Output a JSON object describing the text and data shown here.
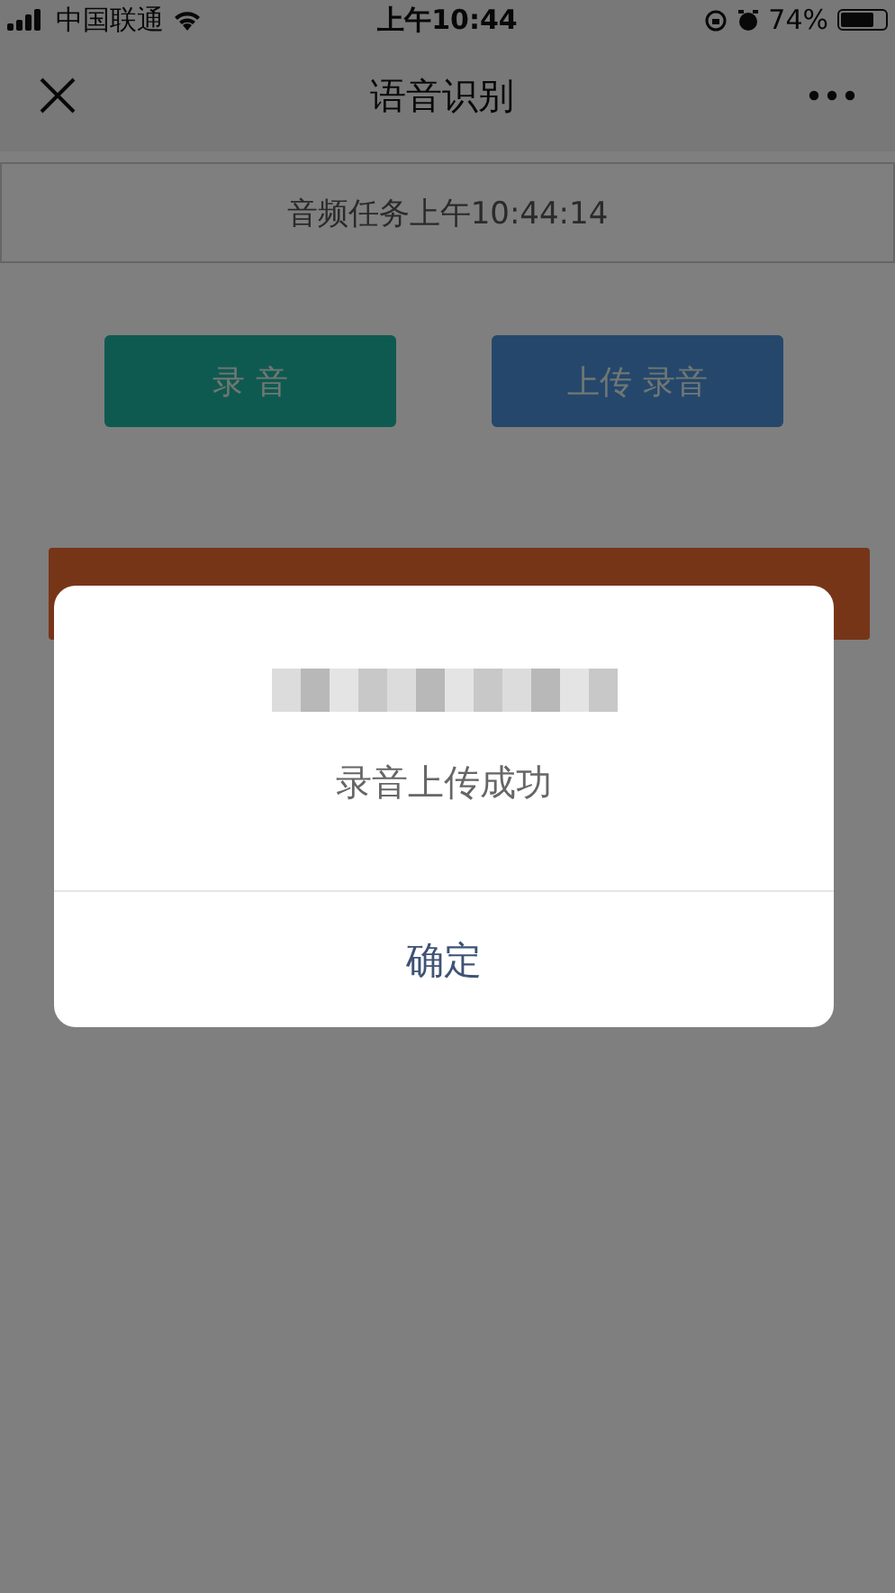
{
  "status_bar": {
    "carrier": "中国联通",
    "time": "上午10:44",
    "battery": {
      "text": "74%",
      "level": 0.74
    }
  },
  "nav": {
    "title": "语音识别"
  },
  "task_label": "音频任务上午10:44:14",
  "buttons": [
    {
      "label": "录 音",
      "kind": "record"
    },
    {
      "label": "上传 录音",
      "kind": "upload"
    }
  ],
  "wide_button": {
    "kind": "recognize"
  },
  "dialog": {
    "message": "录音上传成功",
    "button": "确定"
  }
}
